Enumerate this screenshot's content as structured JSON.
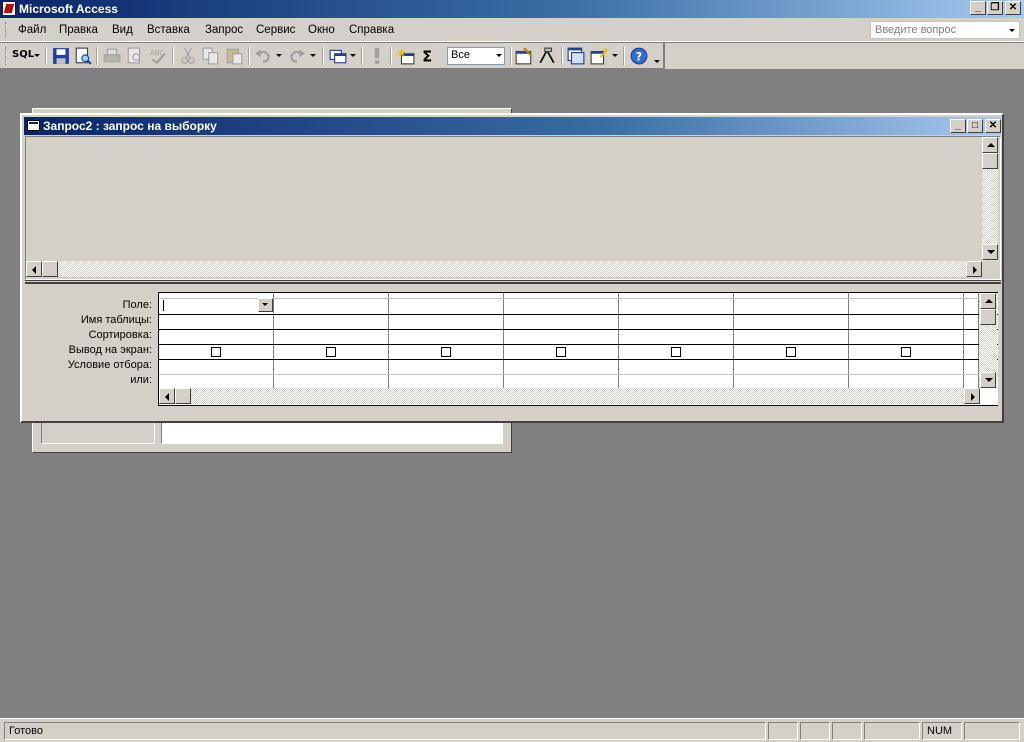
{
  "app": {
    "title": "Microsoft Access",
    "window_buttons": [
      "_",
      "❐",
      "✕"
    ]
  },
  "menu": {
    "items": [
      "Файл",
      "Правка",
      "Вид",
      "Вставка",
      "Запрос",
      "Сервис",
      "Окно",
      "Справка"
    ],
    "ask_placeholder": "Введите вопрос"
  },
  "toolbar": {
    "sql_label": "SQL",
    "top_values": "Все",
    "icons": [
      "view-icon",
      "save-icon",
      "print-preview-icon",
      "print-icon",
      "preview-icon",
      "spelling-icon",
      "cut-icon",
      "copy-icon",
      "paste-icon",
      "undo-icon",
      "redo-icon",
      "query-type-icon",
      "run-icon",
      "show-table-icon",
      "totals-icon",
      "properties-icon",
      "build-icon",
      "database-window-icon",
      "new-object-icon",
      "help-icon"
    ]
  },
  "query_window": {
    "title": "Запрос2 : запрос на выборку",
    "row_labels": [
      "Поле:",
      "Имя таблицы:",
      "Сортировка:",
      "Вывод на экран:",
      "Условие отбора:",
      "или:"
    ],
    "column_count": 7
  },
  "status": {
    "text": "Готово",
    "num": "NUM"
  }
}
